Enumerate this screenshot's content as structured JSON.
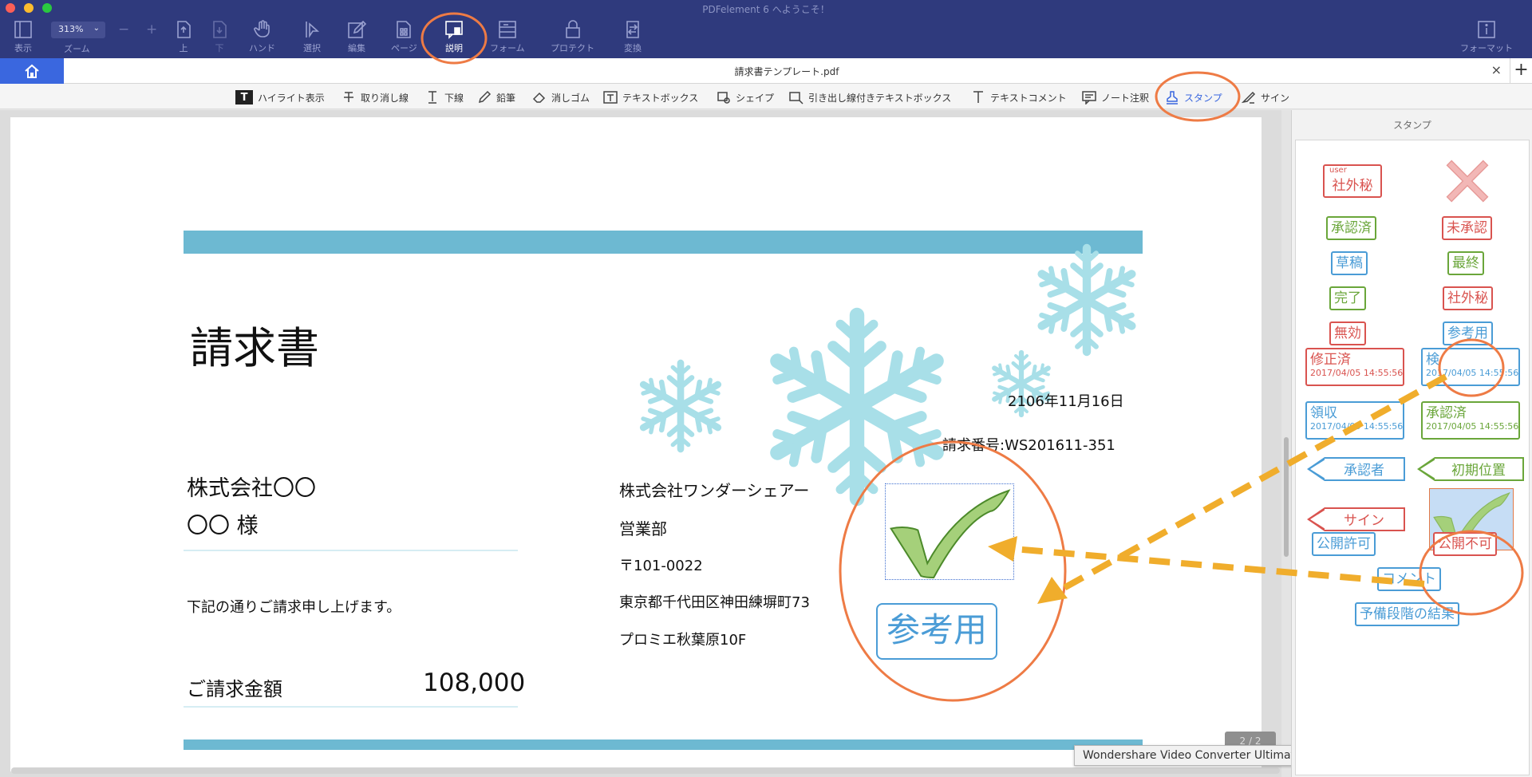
{
  "window": {
    "title": "PDFelement 6 へようこそ！"
  },
  "toolbar": {
    "zoom_value": "313%",
    "zoom_label": "ズーム",
    "zoom_out": "−",
    "zoom_in": "+",
    "items": [
      {
        "label": "表示",
        "icon": "sidebar-view-icon"
      },
      {
        "label": "上",
        "icon": "page-up-icon"
      },
      {
        "label": "下",
        "icon": "page-down-icon"
      },
      {
        "label": "ハンド",
        "icon": "hand-icon"
      },
      {
        "label": "選択",
        "icon": "cursor-select-icon"
      },
      {
        "label": "編集",
        "icon": "edit-pencil-icon"
      },
      {
        "label": "ページ",
        "icon": "page-icon"
      },
      {
        "label": "説明",
        "icon": "comment-icon",
        "active": true
      },
      {
        "label": "フォーム",
        "icon": "form-icon"
      },
      {
        "label": "プロテクト",
        "icon": "lock-icon"
      },
      {
        "label": "変換",
        "icon": "convert-icon"
      },
      {
        "label": "フォーマット",
        "icon": "info-icon"
      }
    ]
  },
  "tabs": {
    "home_icon": "home-icon",
    "document": "請求書テンプレート.pdf",
    "close": "×",
    "add": "+"
  },
  "annotation_tools": [
    {
      "label": "ハイライト表示",
      "icon": "highlight-icon"
    },
    {
      "label": "取り消し線",
      "icon": "strikethrough-icon"
    },
    {
      "label": "下線",
      "icon": "underline-icon"
    },
    {
      "label": "鉛筆",
      "icon": "pencil-icon"
    },
    {
      "label": "消しゴム",
      "icon": "eraser-icon"
    },
    {
      "label": "テキストボックス",
      "icon": "textbox-icon"
    },
    {
      "label": "シェイプ",
      "icon": "shape-icon"
    },
    {
      "label": "引き出し線付きテキストボックス",
      "icon": "callout-icon"
    },
    {
      "label": "テキストコメント",
      "icon": "text-comment-icon"
    },
    {
      "label": "ノート注釈",
      "icon": "note-icon"
    },
    {
      "label": "スタンプ",
      "icon": "stamp-icon",
      "active": true
    },
    {
      "label": "サイン",
      "icon": "signature-icon"
    }
  ],
  "document": {
    "title": "請求書",
    "date": "2106年11月16日",
    "invoice_number": "請求番号:WS201611-351",
    "client_company": "株式会社〇〇",
    "client_name": "〇〇 様",
    "message": "下記の通りご請求申し上げます。",
    "amount_label": "ご請求金額",
    "amount_value": "108,000",
    "sender_company": "株式会社ワンダーシェアー",
    "sender_dept": "営業部",
    "postal": "〒101-0022",
    "address1": "東京都千代田区神田練塀町73",
    "address2": "プロミエ秋葉原10F",
    "placed_stamp": "参考用",
    "page_indicator": "2 / 2"
  },
  "tooltip": "Wondershare Video Converter Ultimate",
  "stamp_panel": {
    "title": "スタンプ",
    "stamps": {
      "confidential_user": {
        "small": "user",
        "label": "社外秘"
      },
      "reject": {
        "icon": "red-x-icon"
      },
      "approved": "承認済",
      "unapproved": "未承認",
      "draft": "草稿",
      "final": "最終",
      "completed": "完了",
      "confidential": "社外秘",
      "void": "無効",
      "for_reference": "参考用",
      "revised": {
        "label": "修正済",
        "date": "2017/04/05 14:55:56"
      },
      "inspected": {
        "label": "検",
        "date": "2017/04/05 14:55:56"
      },
      "received": {
        "label": "領収",
        "date": "2017/04/05 14:55:56"
      },
      "approved_dated": {
        "label": "承認済",
        "date": "2017/04/05 14:55:56"
      },
      "approver": "承認者",
      "initial_position": "初期位置",
      "sign": "サイン",
      "check": {
        "icon": "check-mark-icon"
      },
      "public_allowed": "公開許可",
      "public_denied": "公開不可",
      "comment": "コメント",
      "preliminary": "予備段階の結果"
    }
  },
  "colors": {
    "toolbar_bg": "#2f3a7d",
    "home_tab": "#3a67df",
    "band": "#6db9d2",
    "snowflake": "#a8dfe8",
    "highlight_circle": "#ee7b45",
    "arrow": "#f0ad2c",
    "check_fill": "#a5d07a"
  }
}
